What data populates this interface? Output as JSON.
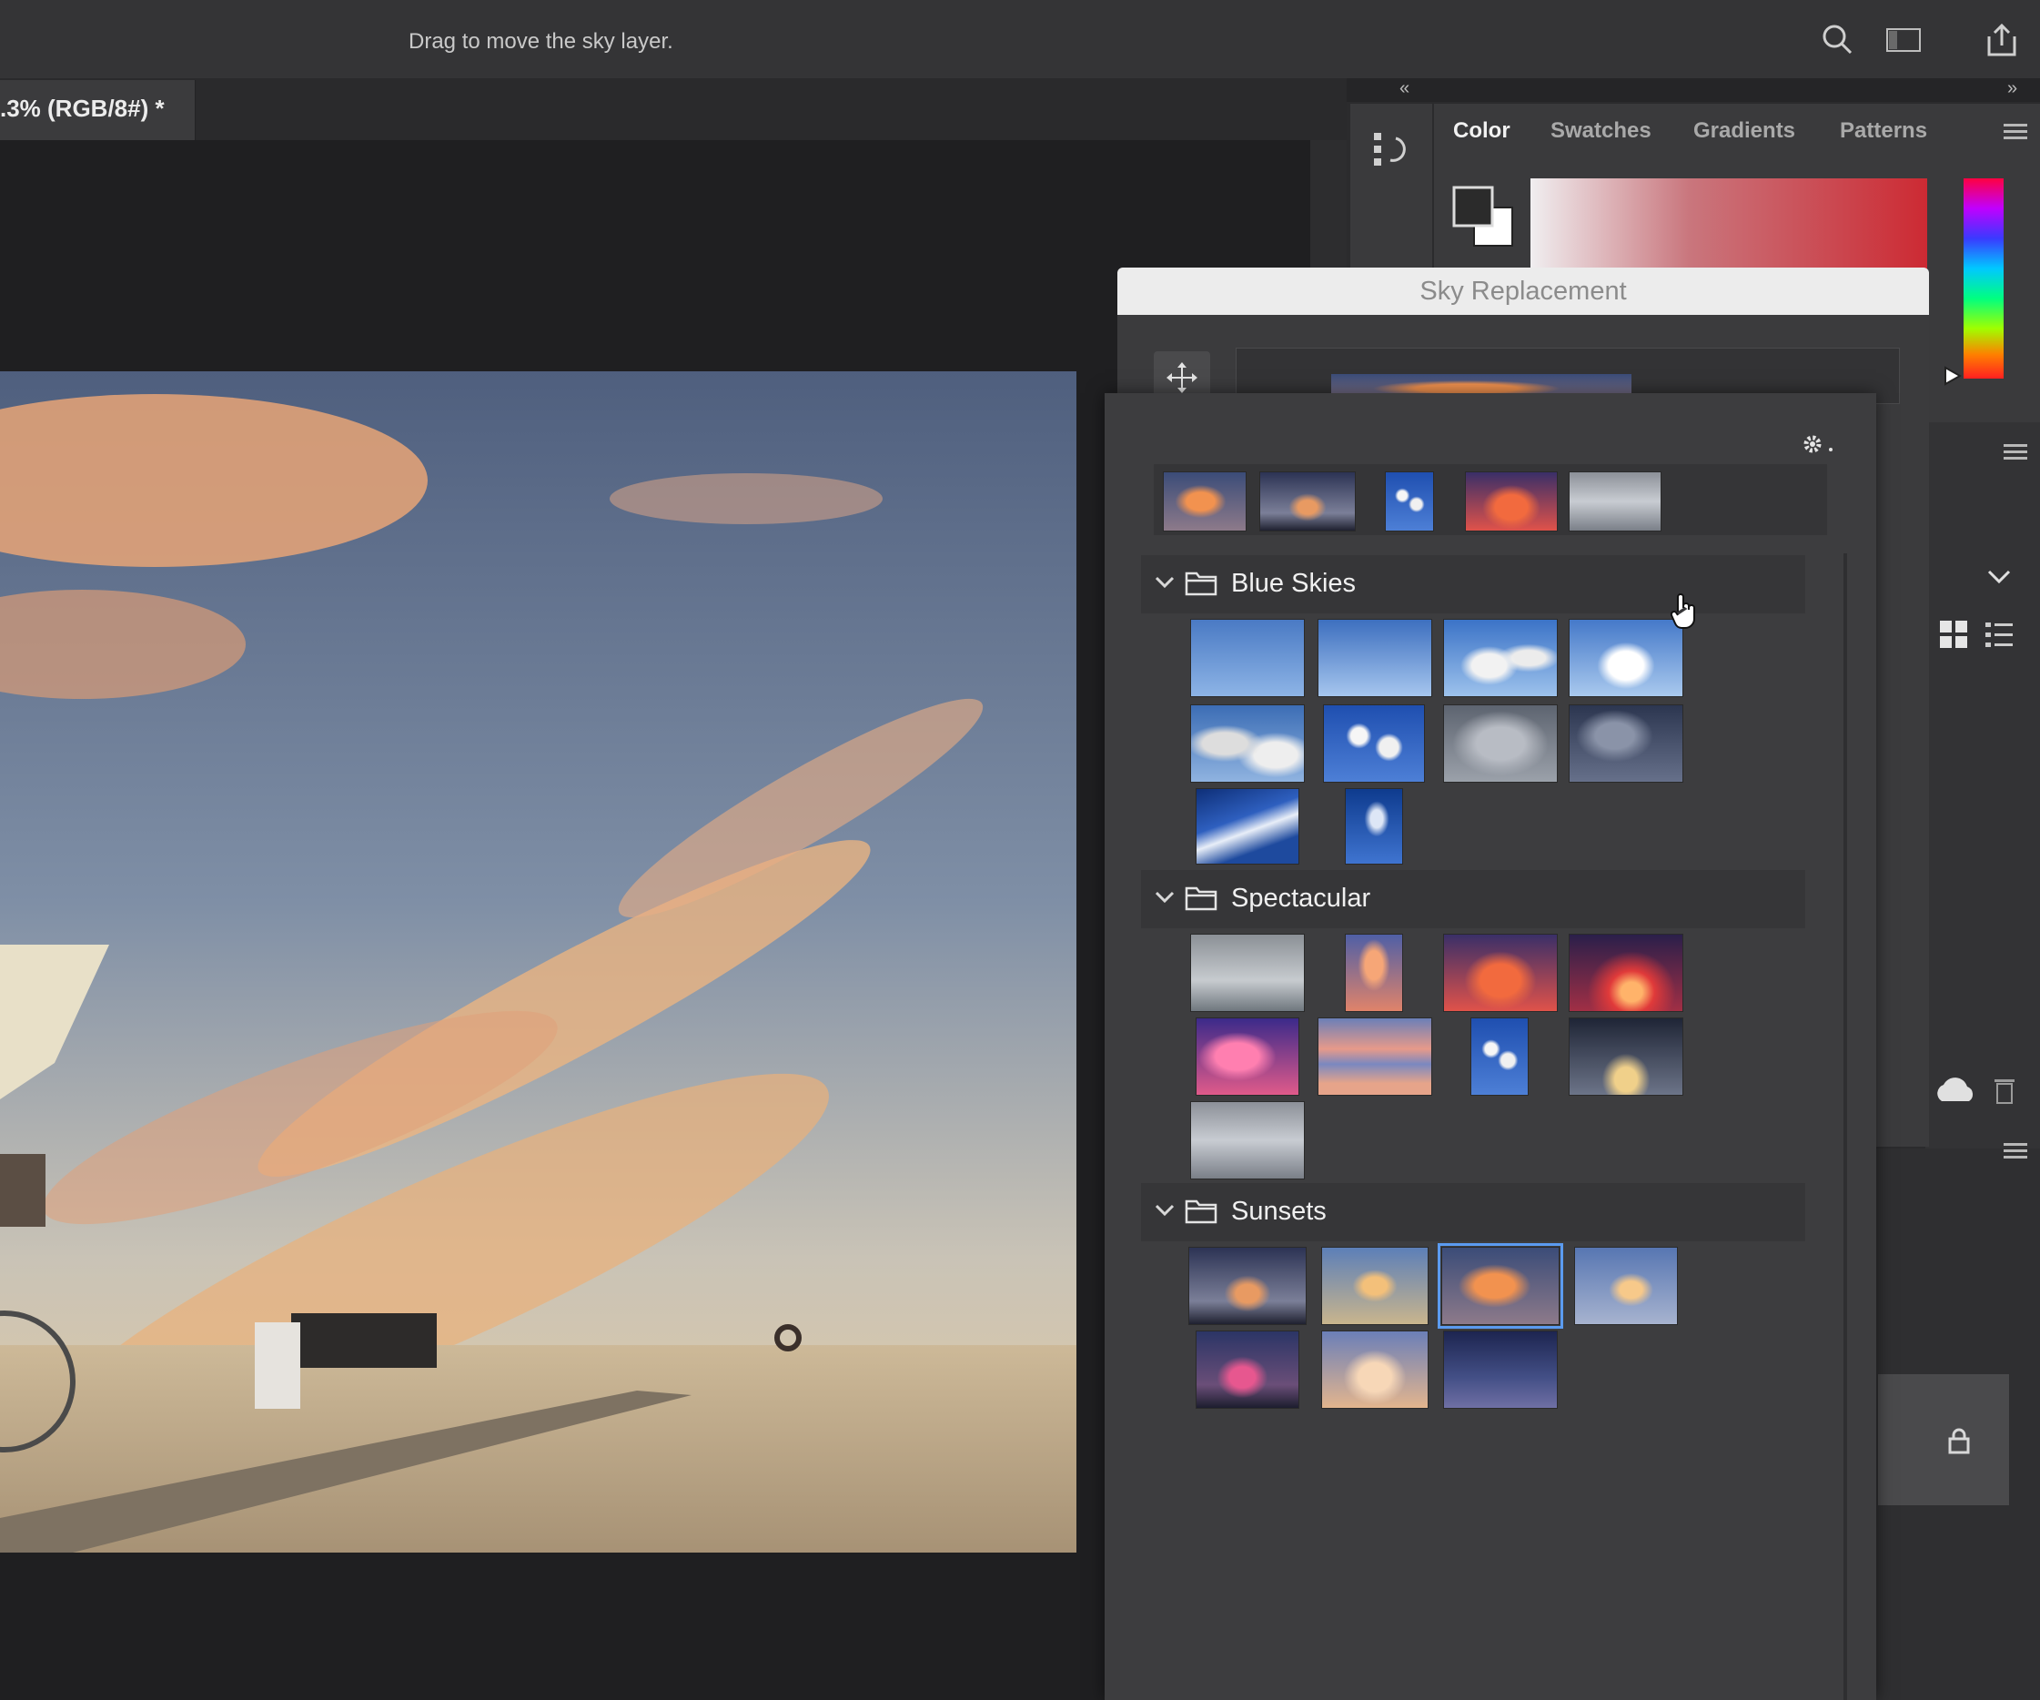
{
  "options_bar": {
    "hint": "Drag to move the sky layer."
  },
  "document": {
    "tab_label": ".3% (RGB/8#) *"
  },
  "color_panel": {
    "tabs": [
      "Color",
      "Swatches",
      "Gradients",
      "Patterns"
    ],
    "active_tab": "Color"
  },
  "sky_dialog": {
    "title": "Sky Replacement",
    "folders": [
      {
        "label": "Blue Skies",
        "count": 10
      },
      {
        "label": "Spectacular",
        "count": 9
      },
      {
        "label": "Sunsets",
        "count": 7
      }
    ],
    "selected_preset": "Sunsets 3"
  },
  "icons": [
    "search-icon",
    "workspace-icon",
    "share-icon",
    "history-icon",
    "move-icon",
    "gear-icon",
    "chevron-down-icon",
    "folder-icon",
    "grid-view-icon",
    "list-view-icon",
    "cloud-icon",
    "trash-icon",
    "lock-icon",
    "panel-menu-icon",
    "hand-cursor-icon"
  ],
  "colors": {
    "accent_selection": "#5b9bf0",
    "dialog_title_bg": "#ececec"
  }
}
